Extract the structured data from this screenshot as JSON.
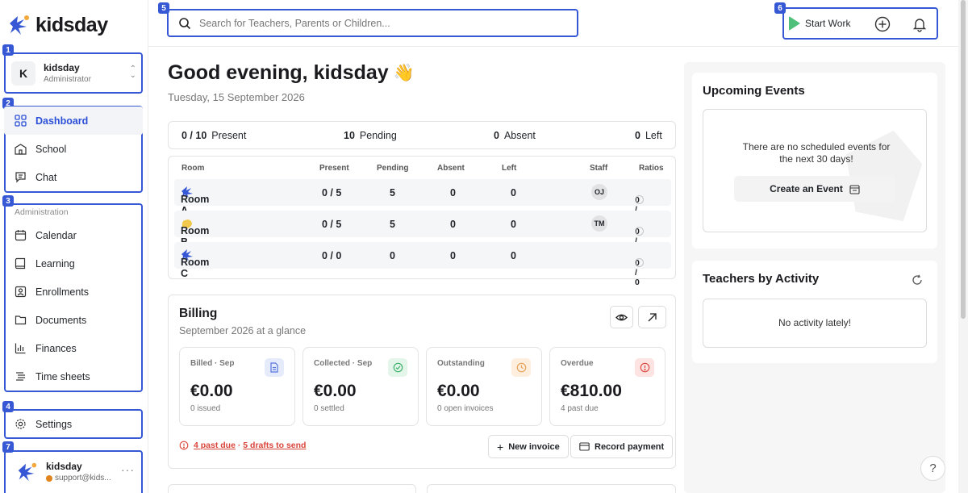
{
  "app": {
    "logo_text": "kidsday"
  },
  "annotations": [
    "1",
    "2",
    "3",
    "4",
    "5",
    "6",
    "7"
  ],
  "account": {
    "initial": "K",
    "name": "kidsday",
    "role": "Administrator"
  },
  "nav_main": [
    {
      "label": "Dashboard",
      "icon": "dashboard-icon",
      "active": true
    },
    {
      "label": "School",
      "icon": "school-icon"
    },
    {
      "label": "Chat",
      "icon": "chat-icon"
    }
  ],
  "nav_admin": {
    "section_label": "Administration",
    "items": [
      {
        "label": "Calendar",
        "icon": "calendar-icon"
      },
      {
        "label": "Learning",
        "icon": "book-icon"
      },
      {
        "label": "Enrollments",
        "icon": "id-card-icon"
      },
      {
        "label": "Documents",
        "icon": "folder-icon"
      },
      {
        "label": "Finances",
        "icon": "bar-chart-icon"
      },
      {
        "label": "Time sheets",
        "icon": "timesheet-icon"
      }
    ]
  },
  "settings": {
    "label": "Settings"
  },
  "user": {
    "name": "kidsday",
    "email": "support@kids..."
  },
  "search": {
    "placeholder": "Search for Teachers, Parents or Children..."
  },
  "top_actions": {
    "start_work": "Start Work"
  },
  "greeting": {
    "text": "Good evening, kidsday",
    "emoji": "👋",
    "date": "Tuesday, 15 September 2026"
  },
  "stats": {
    "present_value": "0 / 10",
    "present_label": "Present",
    "pending_value": "10",
    "pending_label": "Pending",
    "absent_value": "0",
    "absent_label": "Absent",
    "left_value": "0",
    "left_label": "Left"
  },
  "rooms_table": {
    "headers": [
      "Room",
      "Present",
      "Pending",
      "Absent",
      "Left",
      "Staff",
      "Ratios"
    ],
    "rows": [
      {
        "name": "Room A",
        "present": "0 / 5",
        "pending": "5",
        "absent": "0",
        "left": "0",
        "staff": "OJ",
        "ratio": "0 / 0",
        "icon_color": "#3658d4"
      },
      {
        "name": "Room B",
        "present": "0 / 5",
        "pending": "5",
        "absent": "0",
        "left": "0",
        "staff": "TM",
        "ratio": "0 / 0",
        "icon_color": "#f2c94c"
      },
      {
        "name": "Room C",
        "present": "0 / 0",
        "pending": "0",
        "absent": "0",
        "left": "0",
        "staff": "",
        "ratio": "0 / 0",
        "icon_color": "#3658d4"
      }
    ]
  },
  "billing": {
    "title": "Billing",
    "subtitle": "September 2026 at a glance",
    "cards": [
      {
        "label": "Billed · Sep",
        "amount": "€0.00",
        "sub": "0 issued",
        "icon": "document-icon",
        "tint": "#e6ebfb",
        "color": "#5574dc"
      },
      {
        "label": "Collected · Sep",
        "amount": "€0.00",
        "sub": "0 settled",
        "icon": "check-circle-icon",
        "tint": "#e4f5ea",
        "color": "#3fb26b"
      },
      {
        "label": "Outstanding",
        "amount": "€0.00",
        "sub": "0 open invoices",
        "icon": "clock-icon",
        "tint": "#fdeede",
        "color": "#e8a25a"
      },
      {
        "label": "Overdue",
        "amount": "€810.00",
        "sub": "4 past due",
        "icon": "alert-circle-icon",
        "tint": "#fde4e3",
        "color": "#de4b42"
      }
    ],
    "warning_past_due": "4 past due",
    "warning_separator": " · ",
    "warning_drafts": "5 drafts to send",
    "new_invoice": "New invoice",
    "record_payment": "Record payment"
  },
  "upcoming_events": {
    "title": "Upcoming Events",
    "empty": "There are no scheduled events for the next 30 days!",
    "create_button": "Create an Event"
  },
  "teachers_activity": {
    "title": "Teachers by Activity",
    "empty": "No activity lately!"
  },
  "colors": {
    "accent": "#3658d4",
    "danger": "#d9443b",
    "success": "#4ec07a"
  }
}
